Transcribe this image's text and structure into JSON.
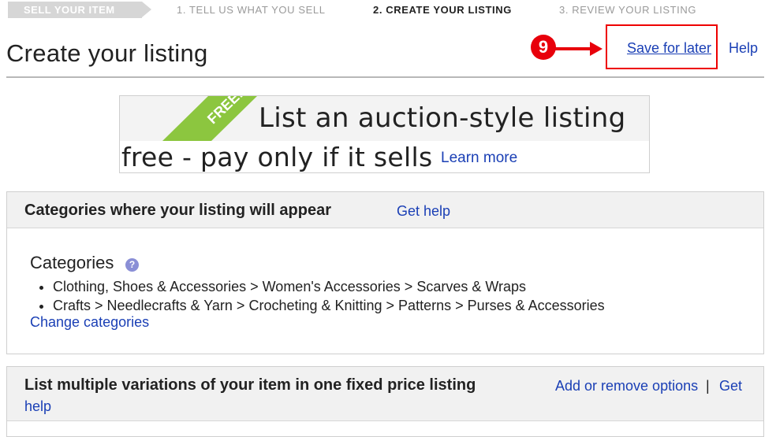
{
  "steps": {
    "current_tag": "SELL YOUR ITEM",
    "step1": "1. TELL US WHAT YOU SELL",
    "step2": "2. CREATE YOUR LISTING",
    "step3": "3. REVIEW YOUR LISTING"
  },
  "header": {
    "title": "Create your listing",
    "callout_number": "9",
    "save_for_later": "Save for later",
    "help": "Help"
  },
  "promo": {
    "ribbon_text": "FREE!",
    "line1": "List an auction-style listing",
    "line2": "free - pay only if it sells",
    "learn_more": "Learn more"
  },
  "categories_panel": {
    "title": "Categories where your listing will appear",
    "get_help": "Get help",
    "label": "Categories",
    "items": [
      "Clothing, Shoes & Accessories > Women's Accessories > Scarves & Wraps",
      "Crafts > Needlecrafts & Yarn > Crocheting & Knitting > Patterns > Purses & Accessories"
    ],
    "change": "Change categories"
  },
  "variations_panel": {
    "title": "List multiple variations of your item in one fixed price listing",
    "add_remove": "Add or remove options",
    "separator": "|",
    "get": "Get",
    "help": "help"
  },
  "colors": {
    "link": "#1a3fb5",
    "callout_red": "#e8000b",
    "ribbon_green": "#8cc63f"
  }
}
